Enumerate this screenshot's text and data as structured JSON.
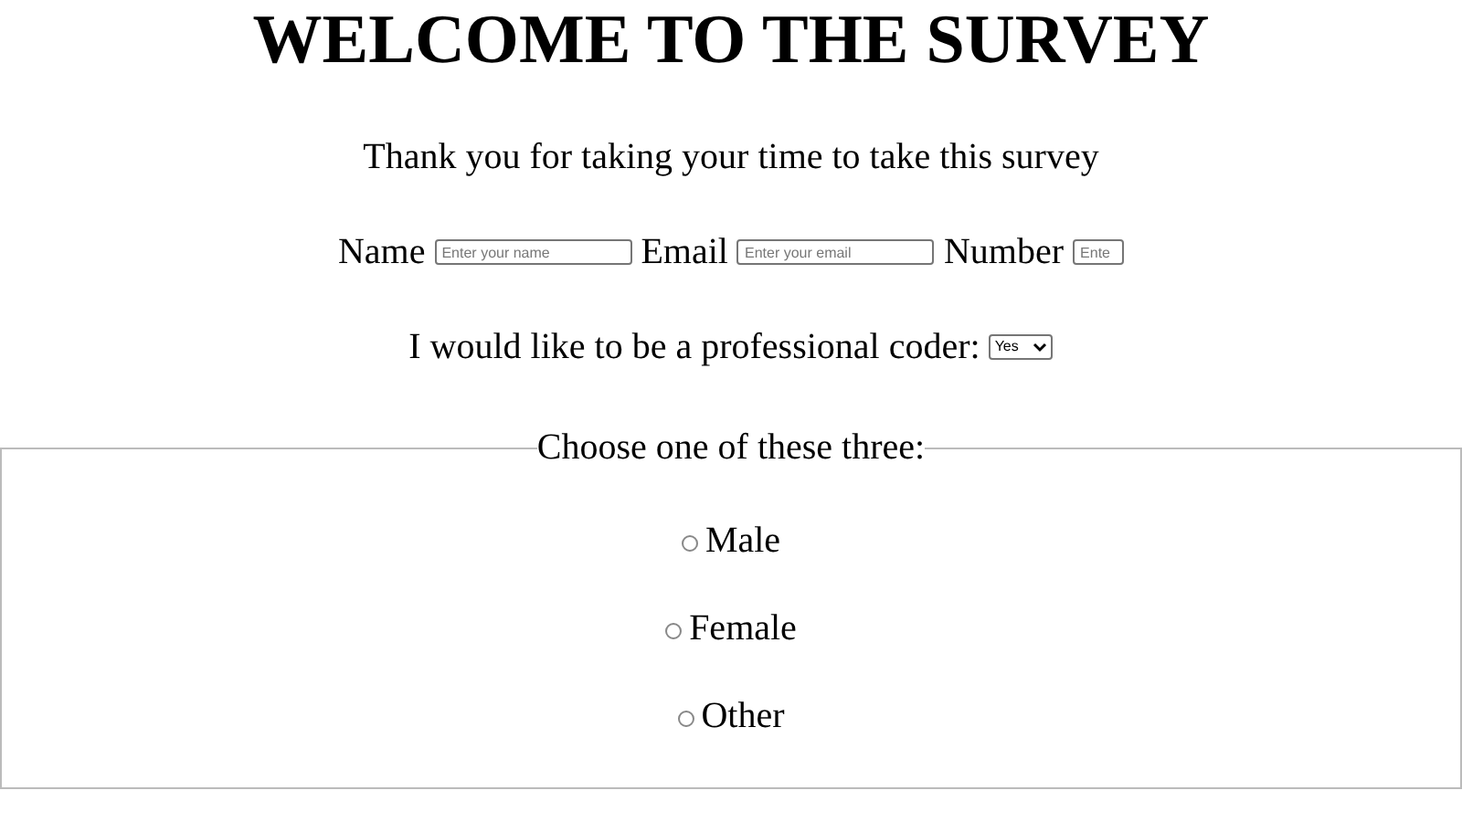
{
  "title": "WELCOME TO THE SURVEY",
  "intro": "Thank you for taking your time to take this survey",
  "fields": [
    {
      "label": "Name",
      "placeholder": "Enter your name",
      "kind": "wide"
    },
    {
      "label": "Email",
      "placeholder": "Enter your email",
      "kind": "wide"
    },
    {
      "label": "Number",
      "placeholder": "Ente",
      "kind": "narrow"
    }
  ],
  "coder": {
    "label": "I would like to be a professional coder:",
    "value": "Yes"
  },
  "choice": {
    "legend": "Choose one of these three:",
    "options": [
      {
        "label": "Male",
        "selected": false
      },
      {
        "label": "Female",
        "selected": false
      },
      {
        "label": "Other",
        "selected": false
      }
    ]
  }
}
